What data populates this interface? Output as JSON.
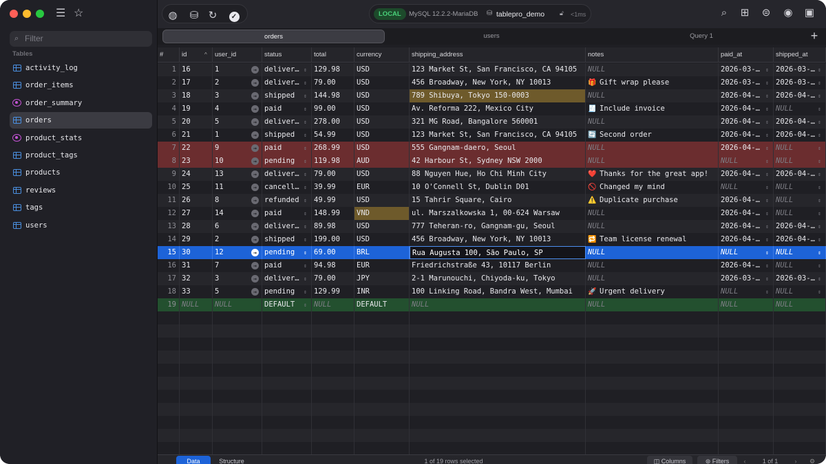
{
  "sidebar": {
    "filter_placeholder": "Filter",
    "section_title": "Tables",
    "items": [
      {
        "label": "activity_log",
        "kind": "table"
      },
      {
        "label": "order_items",
        "kind": "table"
      },
      {
        "label": "order_summary",
        "kind": "view"
      },
      {
        "label": "orders",
        "kind": "table"
      },
      {
        "label": "product_stats",
        "kind": "view"
      },
      {
        "label": "product_tags",
        "kind": "table"
      },
      {
        "label": "products",
        "kind": "table"
      },
      {
        "label": "reviews",
        "kind": "table"
      },
      {
        "label": "tags",
        "kind": "table"
      },
      {
        "label": "users",
        "kind": "table"
      }
    ],
    "active_item": "orders"
  },
  "connection": {
    "badge": "LOCAL",
    "server": "MySQL 12.2.2-MariaDB",
    "database": "tablepro_demo",
    "latency": "<1ms"
  },
  "tabs": [
    "orders",
    "users",
    "Query 1"
  ],
  "active_tab": "orders",
  "columns": [
    "#",
    "id",
    "user_id",
    "status",
    "total",
    "currency",
    "shipping_address",
    "notes",
    "paid_at",
    "shipped_at"
  ],
  "rows": [
    {
      "n": "1",
      "id": "16",
      "user_id": "1",
      "status": "deliver…",
      "total": "129.98",
      "currency": "USD",
      "address": "123 Market St, San Francisco, CA 94105",
      "notes": "NULL",
      "paid_at": "2026-03-…",
      "shipped_at": "2026-03-…"
    },
    {
      "n": "2",
      "id": "17",
      "user_id": "2",
      "status": "deliver…",
      "total": "79.00",
      "currency": "USD",
      "address": "456 Broadway, New York, NY 10013",
      "notes_emoji": "🎁",
      "notes": "Gift wrap please",
      "paid_at": "2026-03-…",
      "shipped_at": "2026-03-…"
    },
    {
      "n": "3",
      "id": "18",
      "user_id": "3",
      "status": "shipped",
      "total": "144.98",
      "currency": "USD",
      "address": "789 Shibuya, Tokyo 150-0003",
      "notes": "NULL",
      "paid_at": "2026-04-…",
      "shipped_at": "2026-04-…"
    },
    {
      "n": "4",
      "id": "19",
      "user_id": "4",
      "status": "paid",
      "total": "99.00",
      "currency": "USD",
      "address": "Av. Reforma 222, Mexico City",
      "notes_emoji": "🧾",
      "notes": "Include invoice",
      "paid_at": "2026-04-…",
      "shipped_at": "NULL"
    },
    {
      "n": "5",
      "id": "20",
      "user_id": "5",
      "status": "deliver…",
      "total": "278.00",
      "currency": "USD",
      "address": "321 MG Road, Bangalore 560001",
      "notes": "NULL",
      "paid_at": "2026-04-…",
      "shipped_at": "2026-04-…"
    },
    {
      "n": "6",
      "id": "21",
      "user_id": "1",
      "status": "shipped",
      "total": "54.99",
      "currency": "USD",
      "address": "123 Market St, San Francisco, CA 94105",
      "notes_emoji": "🔄",
      "notes": "Second order",
      "paid_at": "2026-04-…",
      "shipped_at": "2026-04-…"
    },
    {
      "n": "7",
      "id": "22",
      "user_id": "9",
      "status": "paid",
      "total": "268.99",
      "currency": "USD",
      "address": "555 Gangnam-daero, Seoul",
      "notes": "NULL",
      "paid_at": "2026-04-…",
      "shipped_at": "NULL"
    },
    {
      "n": "8",
      "id": "23",
      "user_id": "10",
      "status": "pending",
      "total": "119.98",
      "currency": "AUD",
      "address": "42 Harbour St, Sydney NSW 2000",
      "notes": "NULL",
      "paid_at": "NULL",
      "shipped_at": "NULL"
    },
    {
      "n": "9",
      "id": "24",
      "user_id": "13",
      "status": "deliver…",
      "total": "79.00",
      "currency": "USD",
      "address": "88 Nguyen Hue, Ho Chi Minh City",
      "notes_emoji": "❤️",
      "notes": "Thanks for the great app!",
      "paid_at": "2026-04-…",
      "shipped_at": "2026-04-…"
    },
    {
      "n": "10",
      "id": "25",
      "user_id": "11",
      "status": "cancell…",
      "total": "39.99",
      "currency": "EUR",
      "address": "10 O'Connell St, Dublin D01",
      "notes_emoji": "🚫",
      "notes": "Changed my mind",
      "paid_at": "NULL",
      "shipped_at": "NULL"
    },
    {
      "n": "11",
      "id": "26",
      "user_id": "8",
      "status": "refunded",
      "total": "49.99",
      "currency": "USD",
      "address": "15 Tahrir Square, Cairo",
      "notes_emoji": "⚠️",
      "notes": "Duplicate purchase",
      "paid_at": "2026-04-…",
      "shipped_at": "NULL"
    },
    {
      "n": "12",
      "id": "27",
      "user_id": "14",
      "status": "paid",
      "total": "148.99",
      "currency": "VND",
      "address": "ul. Marszalkowska 1, 00-624 Warsaw",
      "notes": "NULL",
      "paid_at": "2026-04-…",
      "shipped_at": "NULL"
    },
    {
      "n": "13",
      "id": "28",
      "user_id": "6",
      "status": "deliver…",
      "total": "89.98",
      "currency": "USD",
      "address": "777 Teheran-ro, Gangnam-gu, Seoul",
      "notes": "NULL",
      "paid_at": "2026-04-…",
      "shipped_at": "2026-04-…"
    },
    {
      "n": "14",
      "id": "29",
      "user_id": "2",
      "status": "shipped",
      "total": "199.00",
      "currency": "USD",
      "address": "456 Broadway, New York, NY 10013",
      "notes_emoji": "🔁",
      "notes": "Team license renewal",
      "paid_at": "2026-04-…",
      "shipped_at": "2026-04-…"
    },
    {
      "n": "15",
      "id": "30",
      "user_id": "12",
      "status": "pending",
      "total": "69.00",
      "currency": "BRL",
      "address": "Rua Augusta 100, São Paulo, SP",
      "notes": "NULL",
      "paid_at": "NULL",
      "shipped_at": "NULL"
    },
    {
      "n": "16",
      "id": "31",
      "user_id": "7",
      "status": "paid",
      "total": "94.98",
      "currency": "EUR",
      "address": "Friedrichstraße 43, 10117 Berlin",
      "notes": "NULL",
      "paid_at": "2026-04-…",
      "shipped_at": "NULL"
    },
    {
      "n": "17",
      "id": "32",
      "user_id": "3",
      "status": "deliver…",
      "total": "79.00",
      "currency": "JPY",
      "address": "2-1 Marunouchi, Chiyoda-ku, Tokyo",
      "notes": "NULL",
      "paid_at": "2026-03-…",
      "shipped_at": "2026-03-…"
    },
    {
      "n": "18",
      "id": "33",
      "user_id": "5",
      "status": "pending",
      "total": "129.99",
      "currency": "INR",
      "address": "100 Linking Road, Bandra West, Mumbai",
      "notes_emoji": "🚀",
      "notes": "Urgent delivery",
      "paid_at": "NULL",
      "shipped_at": "NULL"
    },
    {
      "n": "19",
      "id": "NULL",
      "user_id": "NULL",
      "status": "DEFAULT",
      "total": "NULL",
      "currency": "DEFAULT",
      "address": "NULL",
      "notes": "NULL",
      "paid_at": "NULL",
      "shipped_at": "NULL"
    }
  ],
  "highlights": {
    "deleted_rows": [
      7,
      8
    ],
    "selected_row": 15,
    "new_row": 19,
    "modified_cells": [
      {
        "row": 3,
        "col": "address"
      },
      {
        "row": 12,
        "col": "currency"
      }
    ],
    "colors": {
      "deleted": "#6b2d2f",
      "selected": "#1d63d8",
      "new": "#23502f",
      "modified": "#6e5a2b"
    }
  },
  "footer": {
    "data_tab": "Data",
    "structure_tab": "Structure",
    "selection": "1 of 19 rows selected",
    "columns_btn": "Columns",
    "filters_btn": "Filters",
    "pager": "1 of 1"
  }
}
